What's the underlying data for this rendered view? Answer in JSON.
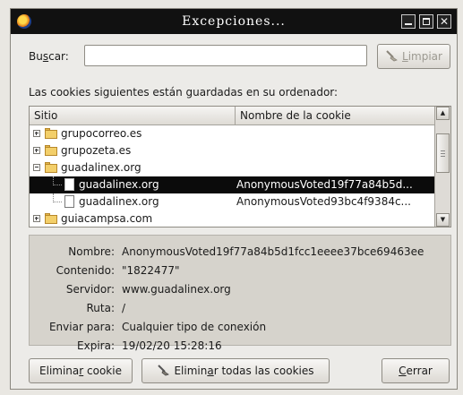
{
  "window": {
    "title": "Excepciones..."
  },
  "search": {
    "label_pre": "Bu",
    "label_key": "s",
    "label_post": "car:",
    "value": "",
    "clear_pre": "",
    "clear_key": "L",
    "clear_post": "impiar"
  },
  "description": "Las cookies siguientes están guardadas en su ordenador:",
  "table": {
    "columns": [
      "Sitio",
      "Nombre de la cookie"
    ],
    "rows": [
      {
        "site": "grupocorreo.es",
        "cookie": ""
      },
      {
        "site": "grupozeta.es",
        "cookie": ""
      },
      {
        "site": "guadalinex.org",
        "cookie": ""
      },
      {
        "site": "guadalinex.org",
        "cookie": "AnonymousVoted19f77a84b5d..."
      },
      {
        "site": "guadalinex.org",
        "cookie": "AnonymousVoted93bc4f9384c..."
      },
      {
        "site": "guiacampsa.com",
        "cookie": ""
      }
    ]
  },
  "details": {
    "labels": [
      "Nombre:",
      "Contenido:",
      "Servidor:",
      "Ruta:",
      "Enviar para:",
      "Expira:"
    ],
    "values": [
      "AnonymousVoted19f77a84b5d1fcc1eeee37bce69463ee",
      "\"1822477\"",
      "www.guadalinex.org",
      "/",
      "Cualquier tipo de conexión",
      "19/02/20 15:28:16"
    ]
  },
  "buttons": {
    "delete_pre": "Elimina",
    "delete_key": "r",
    "delete_post": " cookie",
    "delete_all_pre": "Elimin",
    "delete_all_key": "a",
    "delete_all_post": "r todas las cookies",
    "close_pre": "",
    "close_key": "C",
    "close_post": "errar"
  },
  "colors": {
    "titlebar": "#111111",
    "selection": "#0b0b0b",
    "details_bg": "#d6d3cc"
  }
}
